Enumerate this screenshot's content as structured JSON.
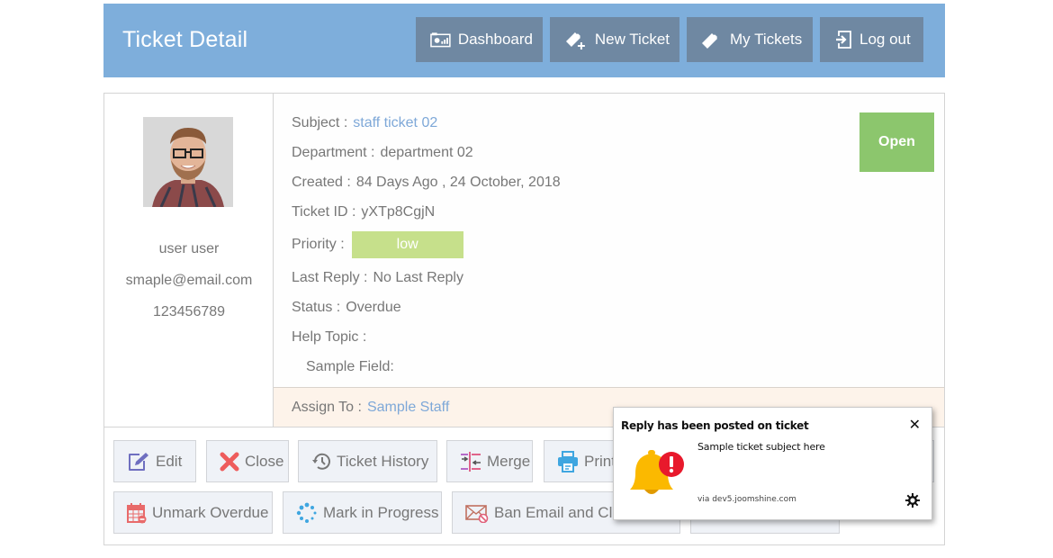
{
  "header": {
    "title": "Ticket Detail",
    "nav": [
      {
        "label": "Dashboard",
        "icon": "dashboard-icon"
      },
      {
        "label": "New Ticket",
        "icon": "new-ticket-icon"
      },
      {
        "label": "My Tickets",
        "icon": "ticket-icon"
      },
      {
        "label": "Log out",
        "icon": "logout-icon"
      }
    ]
  },
  "user": {
    "name": "user user",
    "email": "smaple@email.com",
    "phone": "123456789"
  },
  "ticket": {
    "status_badge": "Open",
    "fields": {
      "subject": {
        "label": "Subject :",
        "value": "staff ticket 02"
      },
      "department": {
        "label": "Department :",
        "value": "department 02"
      },
      "created": {
        "label": "Created :",
        "value": "84 Days Ago , 24 October, 2018"
      },
      "ticket_id": {
        "label": "Ticket ID :",
        "value": "yXTp8CgjN"
      },
      "priority": {
        "label": "Priority :",
        "value": "low"
      },
      "last_reply": {
        "label": "Last Reply :",
        "value": "No Last Reply"
      },
      "status": {
        "label": "Status :",
        "value": "Overdue"
      },
      "help_topic": {
        "label": "Help Topic :",
        "value": ""
      },
      "sample_field": {
        "label": "Sample Field:",
        "value": ""
      }
    },
    "assign": {
      "label": "Assign To :",
      "value": "Sample Staff"
    },
    "colors": {
      "header": "#7eaedb",
      "nav_button": "#6f88a2",
      "open_badge": "#8cc66d",
      "priority_low": "#c6e08b",
      "link": "#7ea8d8",
      "assign_bg": "#fdf3ea"
    }
  },
  "actions": {
    "row1": [
      {
        "label": "Edit",
        "icon": "edit-icon"
      },
      {
        "label": "Close",
        "icon": "close-x-icon"
      },
      {
        "label": "Ticket History",
        "icon": "history-icon"
      },
      {
        "label": "Merge",
        "icon": "merge-icon"
      },
      {
        "label": "Print",
        "icon": "printer-icon"
      }
    ],
    "row2": [
      {
        "label": "Unmark Overdue",
        "icon": "calendar-icon"
      },
      {
        "label": "Mark in Progress",
        "icon": "spinner-icon"
      },
      {
        "label": "Ban Email and Close",
        "icon": "ban-email-icon"
      }
    ]
  },
  "notification": {
    "title": "Reply has been posted on ticket",
    "body": "Sample ticket subject here",
    "source": "via dev5.joomshine.com",
    "close": "✕"
  }
}
